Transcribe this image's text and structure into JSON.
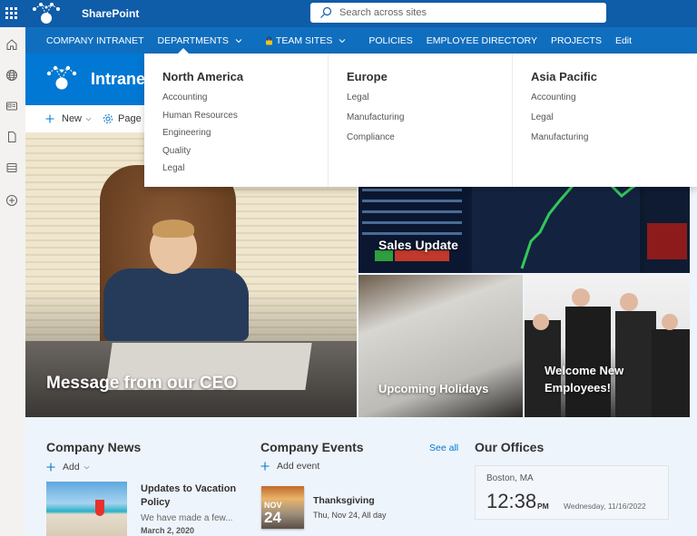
{
  "suite_bar": {
    "app_name": "SharePoint",
    "search_placeholder": "Search across sites"
  },
  "left_rail": {
    "icons": [
      "home-icon",
      "globe-icon",
      "news-icon",
      "document-icon",
      "list-icon",
      "add-icon"
    ]
  },
  "hub_nav": {
    "items": [
      {
        "label": "COMPANY INTRANET",
        "has_chevron": false
      },
      {
        "label": "DEPARTMENTS",
        "has_chevron": true,
        "expanded": true
      },
      {
        "label": "TEAM SITES",
        "has_chevron": true,
        "has_lock": true
      },
      {
        "label": "POLICIES",
        "has_chevron": false
      },
      {
        "label": "EMPLOYEE DIRECTORY",
        "has_chevron": false
      },
      {
        "label": "PROJECTS",
        "has_chevron": false
      },
      {
        "label": "Edit",
        "has_chevron": false
      }
    ]
  },
  "departments_menu": {
    "columns": [
      {
        "heading": "North America",
        "links": [
          "Accounting",
          "Human Resources",
          "Engineering",
          "Quality",
          "Legal"
        ]
      },
      {
        "heading": "Europe",
        "links": [
          "Legal",
          "Manufacturing",
          "Compliance"
        ]
      },
      {
        "heading": "Asia Pacific",
        "links": [
          "Accounting",
          "Legal",
          "Manufacturing"
        ]
      }
    ]
  },
  "site_header": {
    "title": "Intranet"
  },
  "command_bar": {
    "new_label": "New",
    "page_details_label": "Page d"
  },
  "hero": {
    "tiles": [
      {
        "title": "Message from our CEO"
      },
      {
        "title": "Sales Update"
      },
      {
        "title": "Upcoming Holidays"
      },
      {
        "title": "Welcome New Employees!",
        "line1": "Welcome New",
        "line2": "Employees!"
      }
    ]
  },
  "company_news": {
    "title": "Company News",
    "add_label": "Add",
    "items": [
      {
        "title": "Updates to Vacation Policy",
        "description": "We have made a few...",
        "date": "March 2, 2020"
      }
    ]
  },
  "company_events": {
    "title": "Company Events",
    "see_all_label": "See all",
    "add_label": "Add event",
    "items": [
      {
        "month": "NOV",
        "day": "24",
        "title": "Thanksgiving",
        "when": "Thu, Nov 24, All day"
      }
    ]
  },
  "our_offices": {
    "title": "Our Offices",
    "offices": [
      {
        "city": "Boston, MA",
        "time": "12:38",
        "ampm": "PM",
        "date": "Wednesday, 11/16/2022"
      }
    ]
  },
  "colors": {
    "suite_bar": "#0f5ca8",
    "hub_nav": "#106ebe",
    "site_header": "#0078d4",
    "accent": "#0078d4"
  }
}
